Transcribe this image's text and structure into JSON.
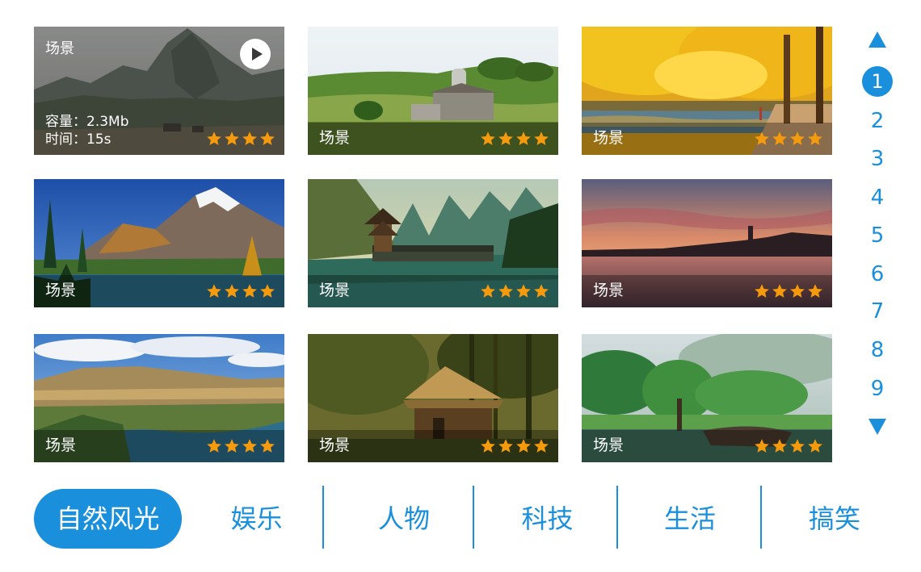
{
  "grid": {
    "tiles": [
      {
        "label": "场景",
        "rating": 4,
        "featured": true,
        "capacity": "容量：2.3Mb",
        "duration": "时间：15s",
        "icon": "play-icon"
      },
      {
        "label": "场景",
        "rating": 4
      },
      {
        "label": "场景",
        "rating": 4
      },
      {
        "label": "场景",
        "rating": 4
      },
      {
        "label": "场景",
        "rating": 4
      },
      {
        "label": "场景",
        "rating": 4
      },
      {
        "label": "场景",
        "rating": 4
      },
      {
        "label": "场景",
        "rating": 4
      },
      {
        "label": "场景",
        "rating": 4
      }
    ]
  },
  "pager": {
    "up_icon": "triangle-up-icon",
    "down_icon": "triangle-down-icon",
    "pages": [
      "1",
      "2",
      "3",
      "4",
      "5",
      "6",
      "7",
      "8",
      "9"
    ],
    "active_index": 0
  },
  "categories": [
    {
      "label": "自然风光",
      "active": true
    },
    {
      "label": "娱乐"
    },
    {
      "label": "人物"
    },
    {
      "label": "科技"
    },
    {
      "label": "生活"
    },
    {
      "label": "搞笑"
    }
  ],
  "colors": {
    "accent": "#1a8fdc",
    "star": "#f59a0c",
    "text_on_image": "#ffffff"
  }
}
